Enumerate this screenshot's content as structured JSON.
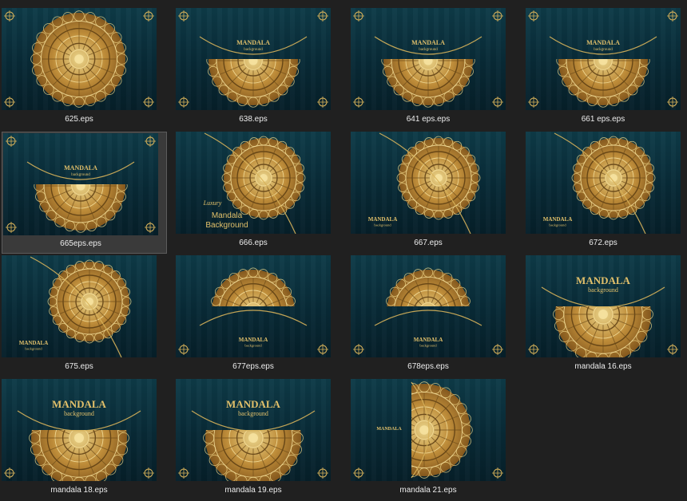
{
  "files": [
    {
      "name": "625.eps",
      "design": "full",
      "selected": false,
      "title": "",
      "subtitle": ""
    },
    {
      "name": "638.eps",
      "design": "bottom",
      "selected": false,
      "title": "MANDALA",
      "subtitle": "background"
    },
    {
      "name": "641 eps.eps",
      "design": "bottom",
      "selected": false,
      "title": "MANDALA",
      "subtitle": "background"
    },
    {
      "name": "661 eps.eps",
      "design": "bottom",
      "selected": false,
      "title": "MANDALA",
      "subtitle": "background"
    },
    {
      "name": "665eps.eps",
      "design": "bottom",
      "selected": true,
      "title": "MANDALA",
      "subtitle": "background"
    },
    {
      "name": "666.eps",
      "design": "corner",
      "selected": false,
      "title": "Luxury Mandala Background",
      "subtitle": ""
    },
    {
      "name": "667.eps",
      "design": "corner",
      "selected": false,
      "title": "MANDALA",
      "subtitle": "background"
    },
    {
      "name": "672.eps",
      "design": "corner",
      "selected": false,
      "title": "MANDALA",
      "subtitle": "background"
    },
    {
      "name": "675.eps",
      "design": "corner",
      "selected": false,
      "title": "MANDALA",
      "subtitle": "background"
    },
    {
      "name": "677eps.eps",
      "design": "top",
      "selected": false,
      "title": "MANDALA",
      "subtitle": "background"
    },
    {
      "name": "678eps.eps",
      "design": "top",
      "selected": false,
      "title": "MANDALA",
      "subtitle": "background"
    },
    {
      "name": "mandala 16.eps",
      "design": "bottom-large",
      "selected": false,
      "title": "MANDALA",
      "subtitle": "background"
    },
    {
      "name": "mandala 18.eps",
      "design": "bottom-large",
      "selected": false,
      "title": "MANDALA",
      "subtitle": "background"
    },
    {
      "name": "mandala 19.eps",
      "design": "bottom-large",
      "selected": false,
      "title": "MANDALA",
      "subtitle": "background"
    },
    {
      "name": "mandala 21.eps",
      "design": "side",
      "selected": false,
      "title": "MANDALA",
      "subtitle": ""
    }
  ],
  "colors": {
    "background": "#202020",
    "gold": "#d8b25a",
    "thumb_bg": "#0b3340",
    "caption": "#ececec"
  },
  "icons": {
    "thumbnail": "mandala-eps-thumbnail"
  }
}
